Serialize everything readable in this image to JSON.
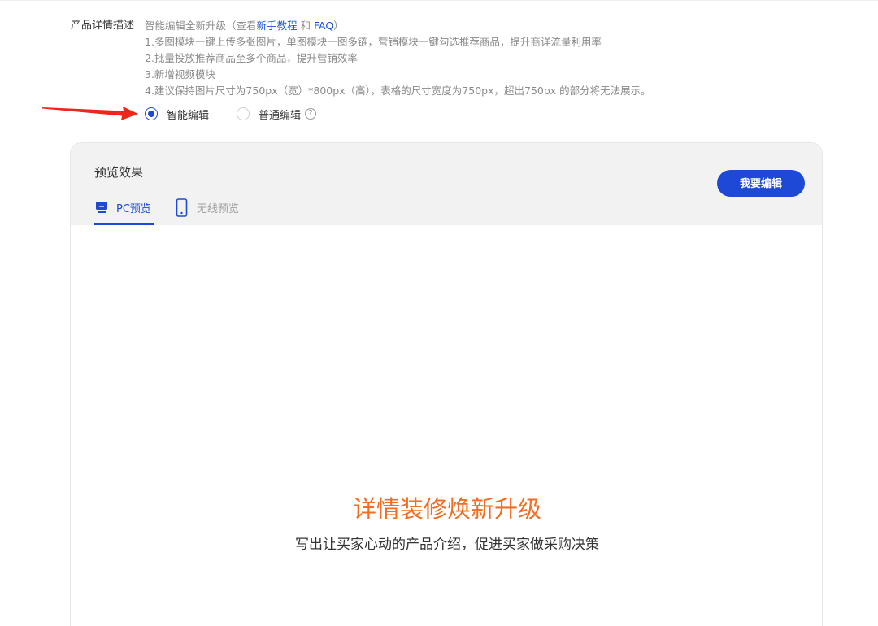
{
  "form": {
    "field_label": "产品详情描述",
    "intro_prefix": "智能编辑全新升级（查看",
    "tutorial_link": "新手教程",
    "intro_and": " 和 ",
    "faq_link": "FAQ",
    "intro_suffix": "）",
    "tips": [
      "1.多图模块一键上传多张图片，单图模块一图多链，营销模块一键勾选推荐商品，提升商详流量利用率",
      "2.批量投放推荐商品至多个商品，提升营销效率",
      "3.新增视频模块",
      "4.建议保持图片尺寸为750px（宽）*800px（高），表格的尺寸宽度为750px，超出750px 的部分将无法展示。"
    ],
    "editor_options": [
      {
        "label": "智能编辑",
        "checked": true
      },
      {
        "label": "普通编辑",
        "checked": false
      }
    ],
    "help_symbol": "?"
  },
  "preview": {
    "title": "预览效果",
    "edit_button": "我要编辑",
    "tabs": [
      {
        "label": "PC预览",
        "active": true,
        "icon": "monitor-icon"
      },
      {
        "label": "无线预览",
        "active": false,
        "icon": "phone-icon"
      }
    ],
    "headline": "详情装修焕新升级",
    "subtext": "写出让买家心动的产品介绍，促进买家做采购决策"
  },
  "colors": {
    "accent": "#1e49d6",
    "link": "#1652d8",
    "headline": "#f26d22",
    "arrow": "#f0261b"
  }
}
